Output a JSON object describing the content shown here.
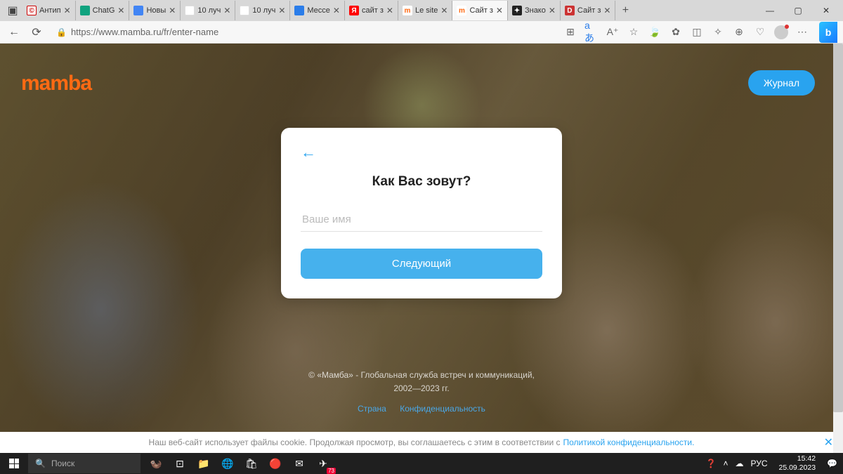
{
  "tabs": [
    {
      "title": "Антип",
      "fav": "©",
      "favClass": "fv-c"
    },
    {
      "title": "ChatG",
      "fav": "",
      "favClass": "fv-green"
    },
    {
      "title": "Новы",
      "fav": "",
      "favClass": "fv-blue"
    },
    {
      "title": "10 луч",
      "fav": "Я",
      "favClass": "fv-ya"
    },
    {
      "title": "10 луч",
      "fav": "✈",
      "favClass": "fv-ya"
    },
    {
      "title": "Мессе",
      "fav": "",
      "favClass": "fv-sq"
    },
    {
      "title": "сайт з",
      "fav": "Я",
      "favClass": "fv-ya2"
    },
    {
      "title": "Le site",
      "fav": "m",
      "favClass": "fv-m"
    },
    {
      "title": "Сайт з",
      "fav": "m",
      "favClass": "fv-m",
      "active": true
    },
    {
      "title": "Знако",
      "fav": "✦",
      "favClass": "fv-dark"
    },
    {
      "title": "Сайт з",
      "fav": "D",
      "favClass": "fv-d"
    }
  ],
  "url": "https://www.mamba.ru/fr/enter-name",
  "logo": "mamba",
  "journal": "Журнал",
  "card": {
    "title": "Как Вас зовут?",
    "placeholder": "Ваше имя",
    "next": "Следующий"
  },
  "footer": {
    "line1": "© «Мамба» - Глобальная служба встреч и коммуникаций,",
    "line2": "2002—2023 гг.",
    "country": "Страна",
    "privacy": "Конфиденциальность"
  },
  "cookie": {
    "text": "Наш веб-сайт использует файлы cookie. Продолжая просмотр, вы соглашаетесь с этим в соответствии с",
    "link": "Политикой конфиденциальности."
  },
  "taskbar": {
    "search": "Поиск",
    "lang": "РУС",
    "time": "15:42",
    "date": "25.09.2023"
  }
}
